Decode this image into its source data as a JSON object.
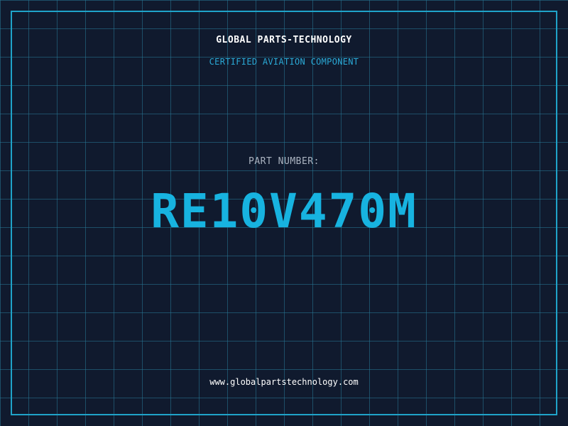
{
  "header": {
    "company": "GLOBAL PARTS-TECHNOLOGY",
    "subtitle": "CERTIFIED AVIATION COMPONENT"
  },
  "part": {
    "label": "PART NUMBER:",
    "number": "RE10V470M"
  },
  "footer": {
    "website": "www.globalpartstechnology.com"
  },
  "colors": {
    "background": "#101a2e",
    "grid": "#287896",
    "frame": "#1fa3c9",
    "accent": "#17b3e0"
  }
}
